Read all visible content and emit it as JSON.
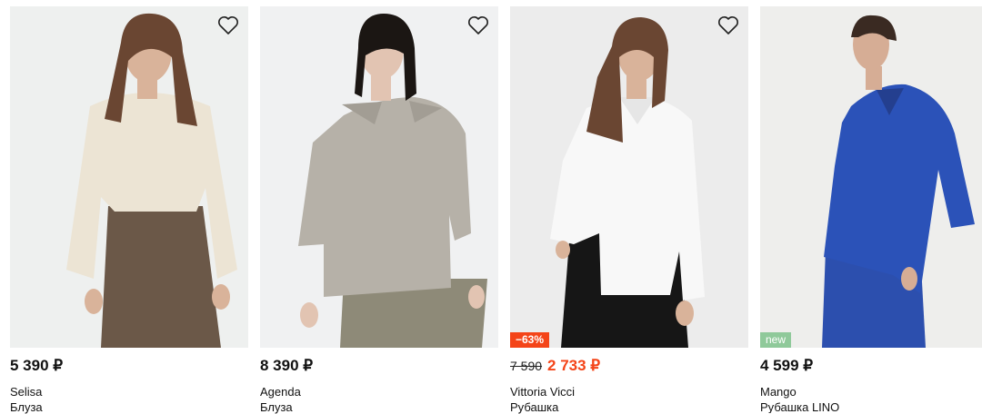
{
  "products": [
    {
      "brand": "Selisa",
      "type": "Блуза",
      "price": "5 390 ₽",
      "colors": {
        "bg": "#eef0ef",
        "top": "#ece4d4",
        "bottom": "#6b5848",
        "skin": "#d9b39a",
        "hair": "#6a4632"
      }
    },
    {
      "brand": "Agenda",
      "type": "Блуза",
      "price": "8 390 ₽",
      "colors": {
        "bg": "#f0f1f2",
        "top": "#b6b1a8",
        "bottom": "#8e8a78",
        "skin": "#e2c4b2",
        "hair": "#1b1613"
      }
    },
    {
      "brand": "Vittoria Vicci",
      "type": "Рубашка",
      "price_old": "7 590",
      "price": "2 733 ₽",
      "badge": "−63%",
      "colors": {
        "bg": "#ececec",
        "top": "#f8f8f8",
        "bottom": "#161616",
        "skin": "#d9b39a",
        "hair": "#6a4632",
        "accent": "#f44418"
      }
    },
    {
      "brand": "Mango",
      "type": "Рубашка LINO",
      "price": "4 599 ₽",
      "badge": "new",
      "colors": {
        "bg": "#eeeeec",
        "top": "#2b52b8",
        "bottom": "#2c4fae",
        "skin": "#d6ad95",
        "hair": "#3a2a22",
        "badge_bg": "#8fc99a"
      }
    }
  ]
}
